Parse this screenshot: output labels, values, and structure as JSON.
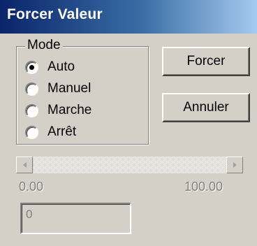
{
  "window": {
    "title": "Forcer Valeur"
  },
  "mode_group": {
    "legend": "Mode",
    "options": [
      {
        "label": "Auto",
        "checked": true
      },
      {
        "label": "Manuel",
        "checked": false
      },
      {
        "label": "Marche",
        "checked": false
      },
      {
        "label": "Arrêt",
        "checked": false
      }
    ]
  },
  "buttons": {
    "force": "Forcer",
    "cancel": "Annuler"
  },
  "slider": {
    "min_label": "0.00",
    "max_label": "100.00",
    "enabled": false
  },
  "value_field": {
    "value": "0",
    "enabled": false
  },
  "icons": {
    "scroll_left": "arrow-left-icon",
    "scroll_right": "arrow-right-icon"
  },
  "colors": {
    "title_start": "#0a246a",
    "title_end": "#a6caf0",
    "face": "#d4d0c8"
  }
}
